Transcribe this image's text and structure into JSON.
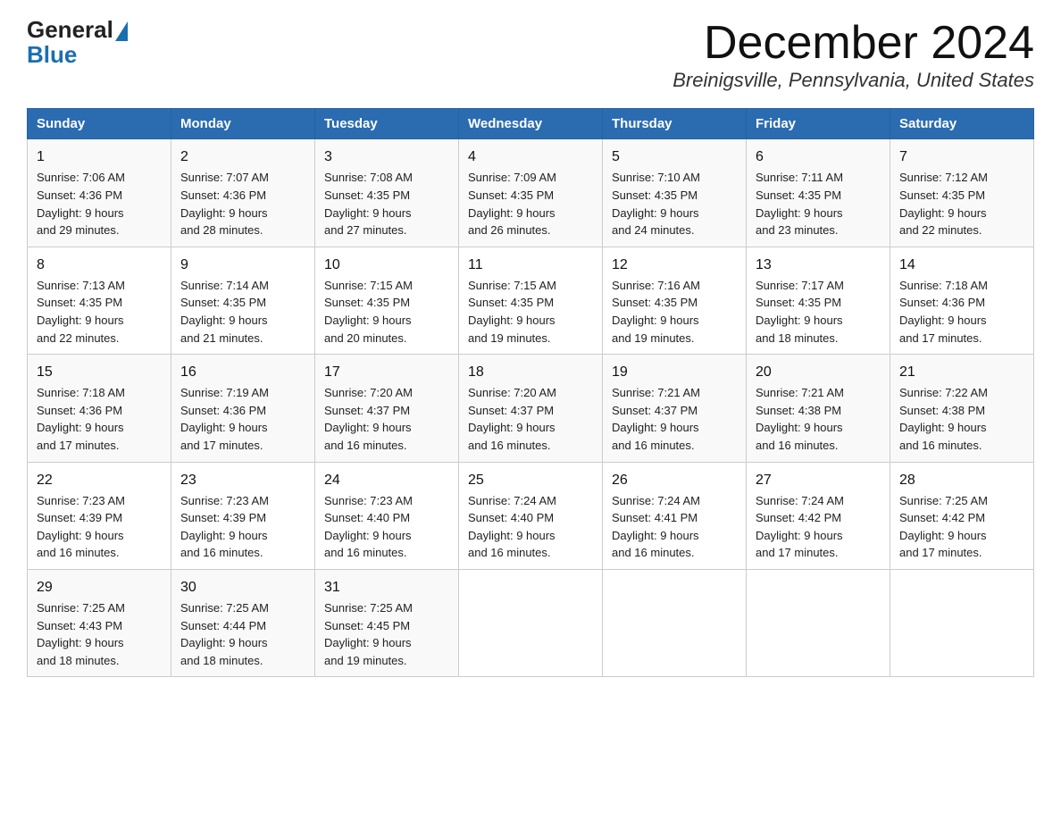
{
  "header": {
    "logo_general": "General",
    "logo_blue": "Blue",
    "month_title": "December 2024",
    "location": "Breinigsville, Pennsylvania, United States"
  },
  "days_of_week": [
    "Sunday",
    "Monday",
    "Tuesday",
    "Wednesday",
    "Thursday",
    "Friday",
    "Saturday"
  ],
  "weeks": [
    [
      {
        "day": "1",
        "sunrise": "7:06 AM",
        "sunset": "4:36 PM",
        "daylight": "9 hours and 29 minutes."
      },
      {
        "day": "2",
        "sunrise": "7:07 AM",
        "sunset": "4:36 PM",
        "daylight": "9 hours and 28 minutes."
      },
      {
        "day": "3",
        "sunrise": "7:08 AM",
        "sunset": "4:35 PM",
        "daylight": "9 hours and 27 minutes."
      },
      {
        "day": "4",
        "sunrise": "7:09 AM",
        "sunset": "4:35 PM",
        "daylight": "9 hours and 26 minutes."
      },
      {
        "day": "5",
        "sunrise": "7:10 AM",
        "sunset": "4:35 PM",
        "daylight": "9 hours and 24 minutes."
      },
      {
        "day": "6",
        "sunrise": "7:11 AM",
        "sunset": "4:35 PM",
        "daylight": "9 hours and 23 minutes."
      },
      {
        "day": "7",
        "sunrise": "7:12 AM",
        "sunset": "4:35 PM",
        "daylight": "9 hours and 22 minutes."
      }
    ],
    [
      {
        "day": "8",
        "sunrise": "7:13 AM",
        "sunset": "4:35 PM",
        "daylight": "9 hours and 22 minutes."
      },
      {
        "day": "9",
        "sunrise": "7:14 AM",
        "sunset": "4:35 PM",
        "daylight": "9 hours and 21 minutes."
      },
      {
        "day": "10",
        "sunrise": "7:15 AM",
        "sunset": "4:35 PM",
        "daylight": "9 hours and 20 minutes."
      },
      {
        "day": "11",
        "sunrise": "7:15 AM",
        "sunset": "4:35 PM",
        "daylight": "9 hours and 19 minutes."
      },
      {
        "day": "12",
        "sunrise": "7:16 AM",
        "sunset": "4:35 PM",
        "daylight": "9 hours and 19 minutes."
      },
      {
        "day": "13",
        "sunrise": "7:17 AM",
        "sunset": "4:35 PM",
        "daylight": "9 hours and 18 minutes."
      },
      {
        "day": "14",
        "sunrise": "7:18 AM",
        "sunset": "4:36 PM",
        "daylight": "9 hours and 17 minutes."
      }
    ],
    [
      {
        "day": "15",
        "sunrise": "7:18 AM",
        "sunset": "4:36 PM",
        "daylight": "9 hours and 17 minutes."
      },
      {
        "day": "16",
        "sunrise": "7:19 AM",
        "sunset": "4:36 PM",
        "daylight": "9 hours and 17 minutes."
      },
      {
        "day": "17",
        "sunrise": "7:20 AM",
        "sunset": "4:37 PM",
        "daylight": "9 hours and 16 minutes."
      },
      {
        "day": "18",
        "sunrise": "7:20 AM",
        "sunset": "4:37 PM",
        "daylight": "9 hours and 16 minutes."
      },
      {
        "day": "19",
        "sunrise": "7:21 AM",
        "sunset": "4:37 PM",
        "daylight": "9 hours and 16 minutes."
      },
      {
        "day": "20",
        "sunrise": "7:21 AM",
        "sunset": "4:38 PM",
        "daylight": "9 hours and 16 minutes."
      },
      {
        "day": "21",
        "sunrise": "7:22 AM",
        "sunset": "4:38 PM",
        "daylight": "9 hours and 16 minutes."
      }
    ],
    [
      {
        "day": "22",
        "sunrise": "7:23 AM",
        "sunset": "4:39 PM",
        "daylight": "9 hours and 16 minutes."
      },
      {
        "day": "23",
        "sunrise": "7:23 AM",
        "sunset": "4:39 PM",
        "daylight": "9 hours and 16 minutes."
      },
      {
        "day": "24",
        "sunrise": "7:23 AM",
        "sunset": "4:40 PM",
        "daylight": "9 hours and 16 minutes."
      },
      {
        "day": "25",
        "sunrise": "7:24 AM",
        "sunset": "4:40 PM",
        "daylight": "9 hours and 16 minutes."
      },
      {
        "day": "26",
        "sunrise": "7:24 AM",
        "sunset": "4:41 PM",
        "daylight": "9 hours and 16 minutes."
      },
      {
        "day": "27",
        "sunrise": "7:24 AM",
        "sunset": "4:42 PM",
        "daylight": "9 hours and 17 minutes."
      },
      {
        "day": "28",
        "sunrise": "7:25 AM",
        "sunset": "4:42 PM",
        "daylight": "9 hours and 17 minutes."
      }
    ],
    [
      {
        "day": "29",
        "sunrise": "7:25 AM",
        "sunset": "4:43 PM",
        "daylight": "9 hours and 18 minutes."
      },
      {
        "day": "30",
        "sunrise": "7:25 AM",
        "sunset": "4:44 PM",
        "daylight": "9 hours and 18 minutes."
      },
      {
        "day": "31",
        "sunrise": "7:25 AM",
        "sunset": "4:45 PM",
        "daylight": "9 hours and 19 minutes."
      },
      null,
      null,
      null,
      null
    ]
  ],
  "labels": {
    "sunrise_label": "Sunrise:",
    "sunset_label": "Sunset:",
    "daylight_label": "Daylight:"
  }
}
